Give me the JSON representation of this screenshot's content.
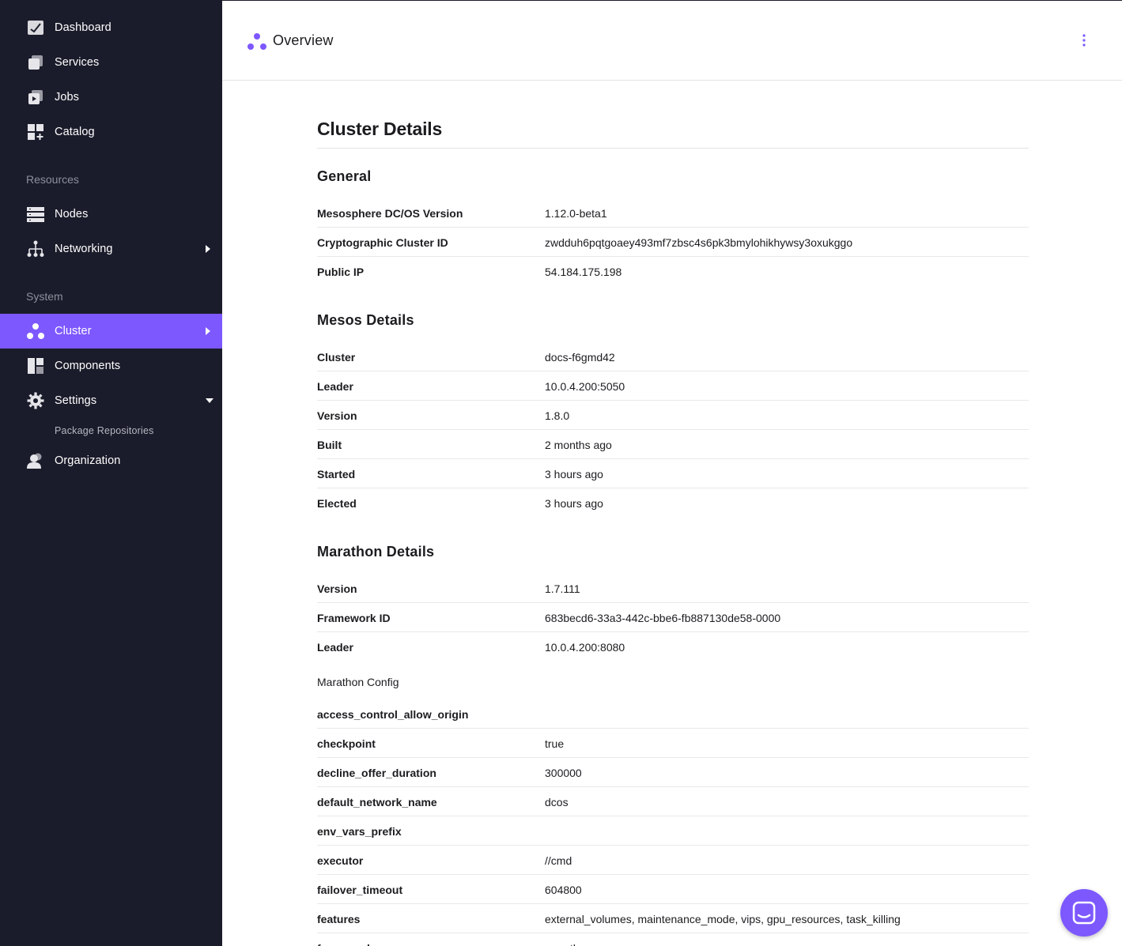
{
  "sidebar": {
    "items_top": [
      {
        "label": "Dashboard",
        "icon": "dashboard-icon"
      },
      {
        "label": "Services",
        "icon": "services-icon"
      },
      {
        "label": "Jobs",
        "icon": "jobs-icon"
      },
      {
        "label": "Catalog",
        "icon": "catalog-icon"
      }
    ],
    "section_resources": "Resources",
    "items_resources": [
      {
        "label": "Nodes",
        "icon": "nodes-icon"
      },
      {
        "label": "Networking",
        "icon": "networking-icon"
      }
    ],
    "section_system": "System",
    "items_system": [
      {
        "label": "Cluster",
        "icon": "cluster-icon"
      },
      {
        "label": "Components",
        "icon": "components-icon"
      },
      {
        "label": "Settings",
        "icon": "gear-icon"
      },
      {
        "label": "Organization",
        "icon": "organization-icon"
      }
    ],
    "settings_sub": "Package Repositories",
    "active_color": "#7d58ff"
  },
  "header": {
    "title": "Overview"
  },
  "main": {
    "heading": "Cluster Details",
    "general": {
      "title": "General",
      "rows": [
        {
          "key": "Mesosphere DC/OS Version",
          "value": "1.12.0-beta1"
        },
        {
          "key": "Cryptographic Cluster ID",
          "value": "zwdduh6pqtgoaey493mf7zbsc4s6pk3bmylohikhywsy3oxukggo"
        },
        {
          "key": "Public IP",
          "value": "54.184.175.198"
        }
      ]
    },
    "mesos": {
      "title": "Mesos Details",
      "rows": [
        {
          "key": "Cluster",
          "value": "docs-f6gmd42"
        },
        {
          "key": "Leader",
          "value": "10.0.4.200:5050"
        },
        {
          "key": "Version",
          "value": "1.8.0"
        },
        {
          "key": "Built",
          "value": "2 months ago"
        },
        {
          "key": "Started",
          "value": "3 hours ago"
        },
        {
          "key": "Elected",
          "value": "3 hours ago"
        }
      ]
    },
    "marathon": {
      "title": "Marathon Details",
      "rows": [
        {
          "key": "Version",
          "value": "1.7.111"
        },
        {
          "key": "Framework ID",
          "value": "683becd6-33a3-442c-bbe6-fb887130de58-0000"
        },
        {
          "key": "Leader",
          "value": "10.0.4.200:8080"
        }
      ],
      "config_label": "Marathon Config",
      "config_rows": [
        {
          "key": "access_control_allow_origin",
          "value": ""
        },
        {
          "key": "checkpoint",
          "value": "true"
        },
        {
          "key": "decline_offer_duration",
          "value": "300000"
        },
        {
          "key": "default_network_name",
          "value": "dcos"
        },
        {
          "key": "env_vars_prefix",
          "value": ""
        },
        {
          "key": "executor",
          "value": "//cmd"
        },
        {
          "key": "failover_timeout",
          "value": "604800"
        },
        {
          "key": "features",
          "value": "external_volumes, maintenance_mode, vips, gpu_resources, task_killing"
        },
        {
          "key": "framework_name",
          "value": "marathon"
        }
      ]
    }
  }
}
